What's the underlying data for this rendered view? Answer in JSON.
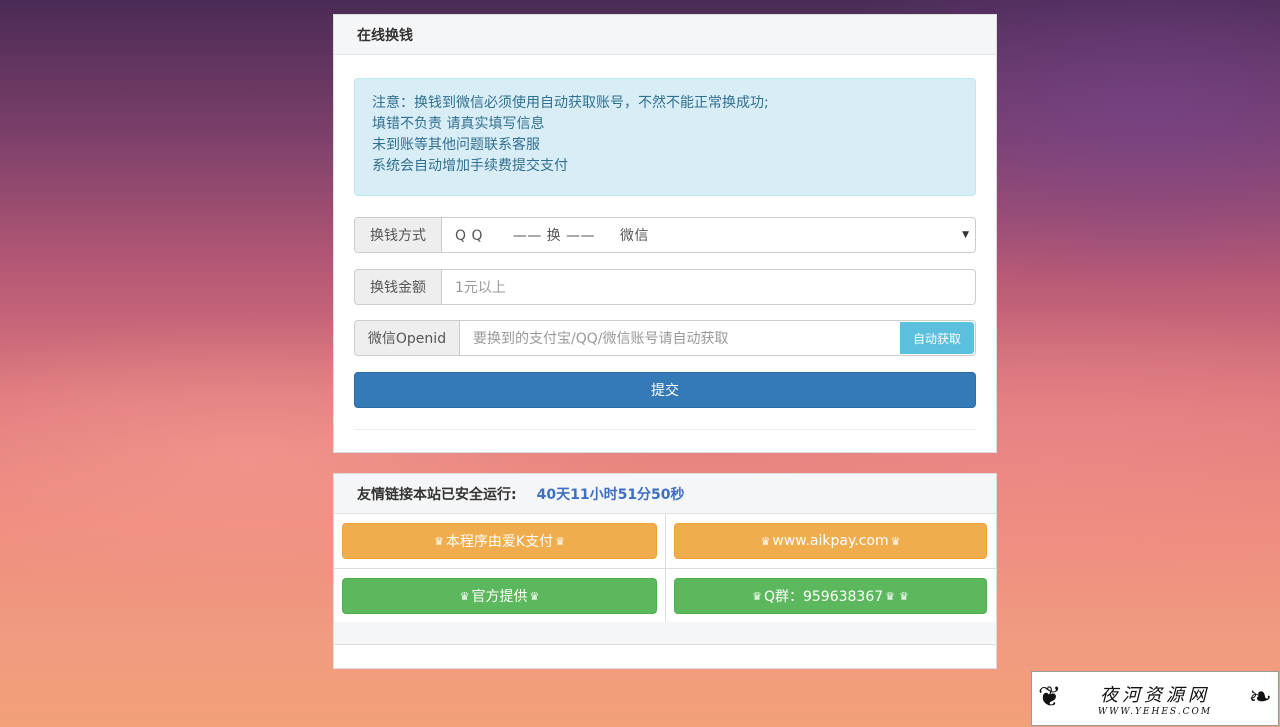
{
  "main_panel": {
    "title": "在线换钱",
    "notice_lines": [
      "注意：换钱到微信必须使用自动获取账号，不然不能正常换成功;",
      "填错不负责 请真实填写信息",
      "未到账等其他问题联系客服",
      "系统会自动增加手续费提交支付"
    ],
    "method_label": "换钱方式",
    "method_value": "Q Q      —— 换 ——     微信",
    "amount_label": "换钱金额",
    "amount_placeholder": "1元以上",
    "openid_label": "微信Openid",
    "openid_placeholder": "要换到的支付宝/QQ/微信账号请自动获取",
    "auto_button": "自动获取",
    "submit_button": "提交"
  },
  "links_panel": {
    "title": "友情链接本站已安全运行:",
    "runtime": "40天11小时51分50秒",
    "links": [
      {
        "text": "本程序由爱K支付",
        "color": "orange",
        "crowns_after": 1
      },
      {
        "text": "www.aikpay.com",
        "color": "orange",
        "crowns_after": 1
      },
      {
        "text": "官方提供",
        "color": "green",
        "crowns_after": 1
      },
      {
        "text": "Q群：959638367",
        "color": "green",
        "crowns_after": 2
      }
    ]
  },
  "watermark": {
    "title": "夜河资源网",
    "subtitle": "WWW.YEHES.COM"
  }
}
